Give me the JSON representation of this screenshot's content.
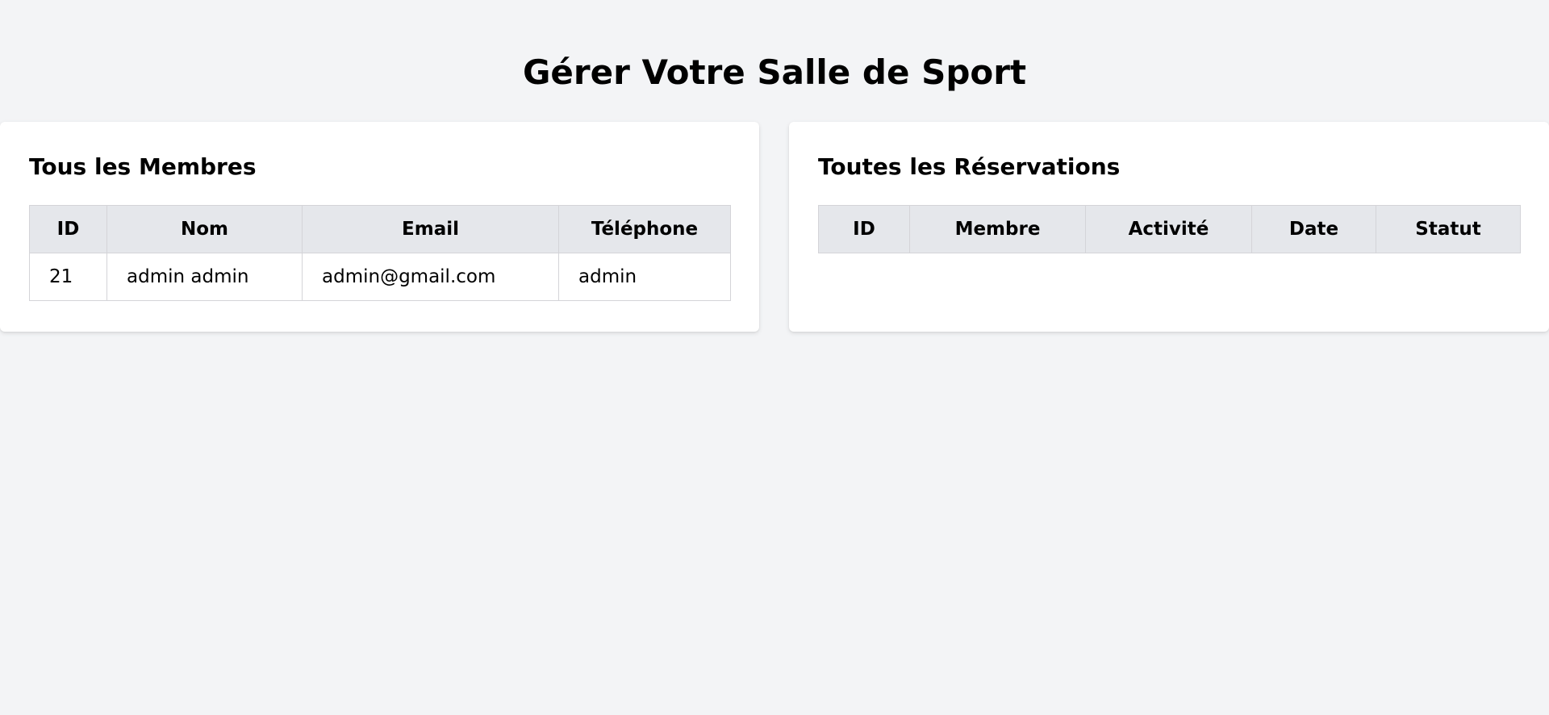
{
  "page": {
    "title": "Gérer Votre Salle de Sport"
  },
  "members": {
    "title": "Tous les Membres",
    "columns": [
      "ID",
      "Nom",
      "Email",
      "Téléphone"
    ],
    "rows": [
      [
        "21",
        "admin admin",
        "admin@gmail.com",
        "admin"
      ]
    ]
  },
  "reservations": {
    "title": "Toutes les Réservations",
    "columns": [
      "ID",
      "Membre",
      "Activité",
      "Date",
      "Statut"
    ],
    "rows": []
  },
  "colors": {
    "background": "#f3f4f6",
    "card": "#ffffff",
    "header_cell": "#e5e7eb",
    "border": "#d4d4d8"
  }
}
